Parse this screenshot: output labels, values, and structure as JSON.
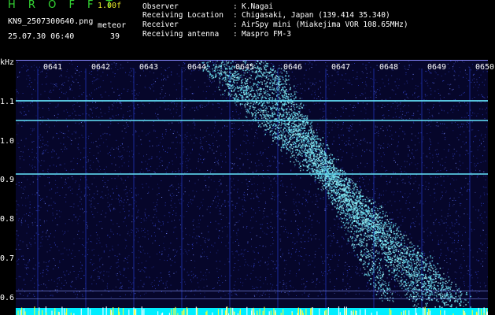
{
  "header": {
    "app_title": "H R O F F T",
    "version": "1.00f",
    "filename": "KN9_2507300640.png",
    "datetime": "25.07.30 06:40",
    "meteor_label": "meteor",
    "meteor_count": "39",
    "meta": [
      {
        "key": "Observer",
        "value": "K.Nagai"
      },
      {
        "key": "Receiving Location",
        "value": "Chigasaki, Japan (139.414 35.340)"
      },
      {
        "key": "Receiver",
        "value": "AirSpy mini (Miakejima VOR 108.65MHz)"
      },
      {
        "key": "Receiving antenna",
        "value": "Maspro FM-3"
      }
    ]
  },
  "plot": {
    "y_unit": "kHz",
    "y_ticks": [
      "1.1",
      "1.0",
      "0.9",
      "0.8",
      "0.7",
      "0.6"
    ],
    "x_ticks": [
      "0641",
      "0642",
      "0643",
      "0644",
      "0645",
      "0646",
      "0647",
      "0648",
      "0649",
      "0650"
    ],
    "colors": {
      "background": "#06062a",
      "noise": "#3344cc",
      "signal": "#66ddee",
      "bottom_band": "#00eeff",
      "peak": "#ffff33"
    }
  }
}
